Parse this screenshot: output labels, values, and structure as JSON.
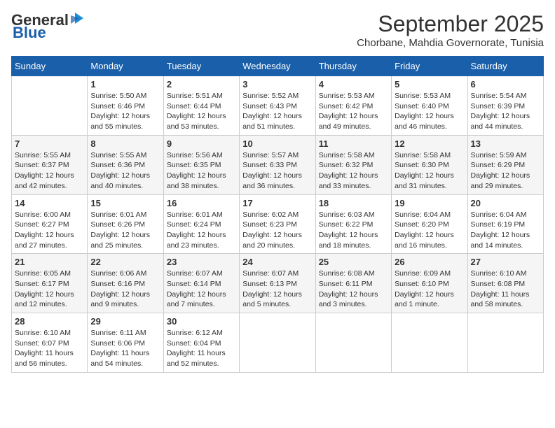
{
  "logo": {
    "part1": "General",
    "part2": "Blue"
  },
  "title": "September 2025",
  "location": "Chorbane, Mahdia Governorate, Tunisia",
  "weekdays": [
    "Sunday",
    "Monday",
    "Tuesday",
    "Wednesday",
    "Thursday",
    "Friday",
    "Saturday"
  ],
  "weeks": [
    [
      {
        "day": "",
        "info": ""
      },
      {
        "day": "1",
        "info": "Sunrise: 5:50 AM\nSunset: 6:46 PM\nDaylight: 12 hours\nand 55 minutes."
      },
      {
        "day": "2",
        "info": "Sunrise: 5:51 AM\nSunset: 6:44 PM\nDaylight: 12 hours\nand 53 minutes."
      },
      {
        "day": "3",
        "info": "Sunrise: 5:52 AM\nSunset: 6:43 PM\nDaylight: 12 hours\nand 51 minutes."
      },
      {
        "day": "4",
        "info": "Sunrise: 5:53 AM\nSunset: 6:42 PM\nDaylight: 12 hours\nand 49 minutes."
      },
      {
        "day": "5",
        "info": "Sunrise: 5:53 AM\nSunset: 6:40 PM\nDaylight: 12 hours\nand 46 minutes."
      },
      {
        "day": "6",
        "info": "Sunrise: 5:54 AM\nSunset: 6:39 PM\nDaylight: 12 hours\nand 44 minutes."
      }
    ],
    [
      {
        "day": "7",
        "info": "Sunrise: 5:55 AM\nSunset: 6:37 PM\nDaylight: 12 hours\nand 42 minutes."
      },
      {
        "day": "8",
        "info": "Sunrise: 5:55 AM\nSunset: 6:36 PM\nDaylight: 12 hours\nand 40 minutes."
      },
      {
        "day": "9",
        "info": "Sunrise: 5:56 AM\nSunset: 6:35 PM\nDaylight: 12 hours\nand 38 minutes."
      },
      {
        "day": "10",
        "info": "Sunrise: 5:57 AM\nSunset: 6:33 PM\nDaylight: 12 hours\nand 36 minutes."
      },
      {
        "day": "11",
        "info": "Sunrise: 5:58 AM\nSunset: 6:32 PM\nDaylight: 12 hours\nand 33 minutes."
      },
      {
        "day": "12",
        "info": "Sunrise: 5:58 AM\nSunset: 6:30 PM\nDaylight: 12 hours\nand 31 minutes."
      },
      {
        "day": "13",
        "info": "Sunrise: 5:59 AM\nSunset: 6:29 PM\nDaylight: 12 hours\nand 29 minutes."
      }
    ],
    [
      {
        "day": "14",
        "info": "Sunrise: 6:00 AM\nSunset: 6:27 PM\nDaylight: 12 hours\nand 27 minutes."
      },
      {
        "day": "15",
        "info": "Sunrise: 6:01 AM\nSunset: 6:26 PM\nDaylight: 12 hours\nand 25 minutes."
      },
      {
        "day": "16",
        "info": "Sunrise: 6:01 AM\nSunset: 6:24 PM\nDaylight: 12 hours\nand 23 minutes."
      },
      {
        "day": "17",
        "info": "Sunrise: 6:02 AM\nSunset: 6:23 PM\nDaylight: 12 hours\nand 20 minutes."
      },
      {
        "day": "18",
        "info": "Sunrise: 6:03 AM\nSunset: 6:22 PM\nDaylight: 12 hours\nand 18 minutes."
      },
      {
        "day": "19",
        "info": "Sunrise: 6:04 AM\nSunset: 6:20 PM\nDaylight: 12 hours\nand 16 minutes."
      },
      {
        "day": "20",
        "info": "Sunrise: 6:04 AM\nSunset: 6:19 PM\nDaylight: 12 hours\nand 14 minutes."
      }
    ],
    [
      {
        "day": "21",
        "info": "Sunrise: 6:05 AM\nSunset: 6:17 PM\nDaylight: 12 hours\nand 12 minutes."
      },
      {
        "day": "22",
        "info": "Sunrise: 6:06 AM\nSunset: 6:16 PM\nDaylight: 12 hours\nand 9 minutes."
      },
      {
        "day": "23",
        "info": "Sunrise: 6:07 AM\nSunset: 6:14 PM\nDaylight: 12 hours\nand 7 minutes."
      },
      {
        "day": "24",
        "info": "Sunrise: 6:07 AM\nSunset: 6:13 PM\nDaylight: 12 hours\nand 5 minutes."
      },
      {
        "day": "25",
        "info": "Sunrise: 6:08 AM\nSunset: 6:11 PM\nDaylight: 12 hours\nand 3 minutes."
      },
      {
        "day": "26",
        "info": "Sunrise: 6:09 AM\nSunset: 6:10 PM\nDaylight: 12 hours\nand 1 minute."
      },
      {
        "day": "27",
        "info": "Sunrise: 6:10 AM\nSunset: 6:08 PM\nDaylight: 11 hours\nand 58 minutes."
      }
    ],
    [
      {
        "day": "28",
        "info": "Sunrise: 6:10 AM\nSunset: 6:07 PM\nDaylight: 11 hours\nand 56 minutes."
      },
      {
        "day": "29",
        "info": "Sunrise: 6:11 AM\nSunset: 6:06 PM\nDaylight: 11 hours\nand 54 minutes."
      },
      {
        "day": "30",
        "info": "Sunrise: 6:12 AM\nSunset: 6:04 PM\nDaylight: 11 hours\nand 52 minutes."
      },
      {
        "day": "",
        "info": ""
      },
      {
        "day": "",
        "info": ""
      },
      {
        "day": "",
        "info": ""
      },
      {
        "day": "",
        "info": ""
      }
    ]
  ]
}
